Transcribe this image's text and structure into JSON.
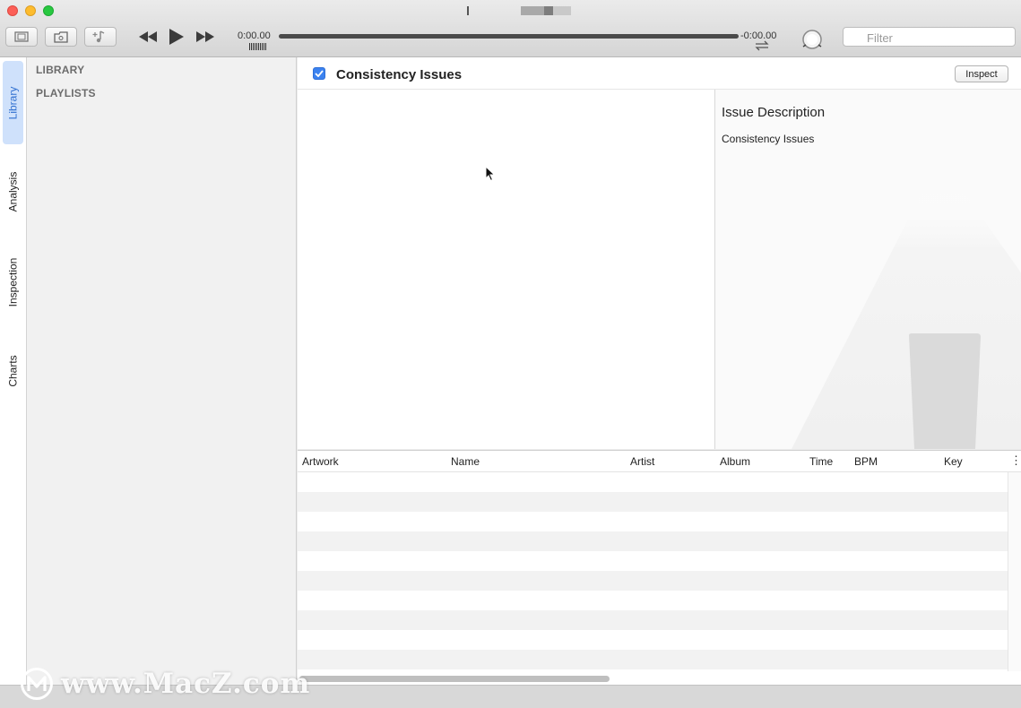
{
  "window": {
    "colors": {
      "close": "#fc5f57",
      "minimize": "#fdbc2e",
      "maximize": "#28c840",
      "accent": "#3b82f0"
    }
  },
  "toolbar": {
    "buttons": [
      {
        "icon": "sidebar-toggle-icon"
      },
      {
        "icon": "browser-icon"
      },
      {
        "icon": "add-music-icon"
      }
    ],
    "elapsed_time": "0:00.00",
    "remaining_time": "-0:00.00",
    "playback_progress": 0,
    "filter_placeholder": "Filter"
  },
  "vertical_tabs": [
    {
      "label": "Library",
      "active": true
    },
    {
      "label": "Analysis",
      "active": false
    },
    {
      "label": "Inspection",
      "active": false
    },
    {
      "label": "Charts",
      "active": false
    }
  ],
  "sidebar": {
    "sections": [
      "LIBRARY",
      "PLAYLISTS"
    ]
  },
  "issues_header": {
    "checked": true,
    "title": "Consistency Issues",
    "inspect_label": "Inspect"
  },
  "description": {
    "heading": "Issue Description",
    "text": "Consistency Issues"
  },
  "table": {
    "columns": [
      "Artwork",
      "Name",
      "Artist",
      "Album",
      "Time",
      "BPM",
      "Key"
    ],
    "row_count": 10,
    "rows": []
  },
  "watermark": {
    "text": "www.MacZ.com"
  }
}
